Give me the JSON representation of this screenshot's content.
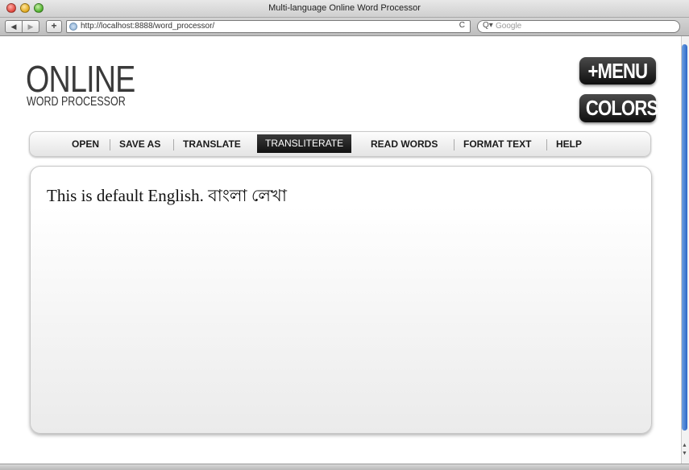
{
  "window": {
    "title": "Multi-language Online Word Processor"
  },
  "toolbar": {
    "back_glyph": "◀",
    "forward_glyph": "▶",
    "add_glyph": "+",
    "url": "http://localhost:8888/word_processor/",
    "reload_glyph": "C",
    "search_icon_glyph": "Q▾",
    "search_placeholder": "Google"
  },
  "logo": {
    "top": "ONLINE",
    "bottom": "WORD PROCESSOR"
  },
  "buttons": {
    "menu": "+MENU",
    "colors": "COLORS"
  },
  "menu": {
    "items": [
      "OPEN",
      "SAVE AS",
      "TRANSLATE",
      "TRANSLITERATE",
      "READ WORDS",
      "FORMAT TEXT",
      "HELP"
    ],
    "active": "TRANSLITERATE"
  },
  "editor": {
    "text": "This is default English. বাংলা লেখা"
  },
  "colors": {
    "accent_dark": "#111111",
    "scroll_accent": "#2c68c8"
  }
}
